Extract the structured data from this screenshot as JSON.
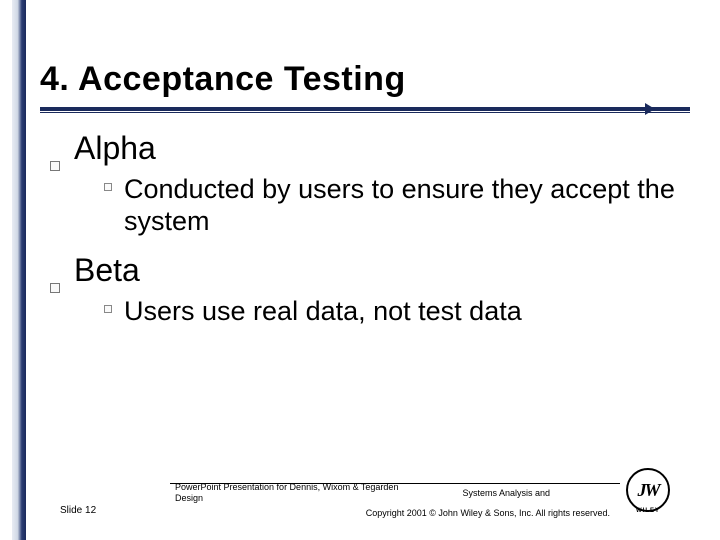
{
  "title": "4. Acceptance Testing",
  "items": [
    {
      "label": "Alpha",
      "sub": "Conducted by users to ensure they accept the system"
    },
    {
      "label": "Beta",
      "sub": "Users use real data, not test data"
    }
  ],
  "footer": {
    "slide": "Slide 12",
    "source_line1": "PowerPoint Presentation for Dennis, Wixom & Tegarden",
    "source_line2": "Design",
    "course": "Systems Analysis and",
    "copyright": "Copyright 2001 © John Wiley & Sons, Inc.  All rights reserved.",
    "logo_initials": "JW",
    "logo_brand": "WILEY"
  }
}
